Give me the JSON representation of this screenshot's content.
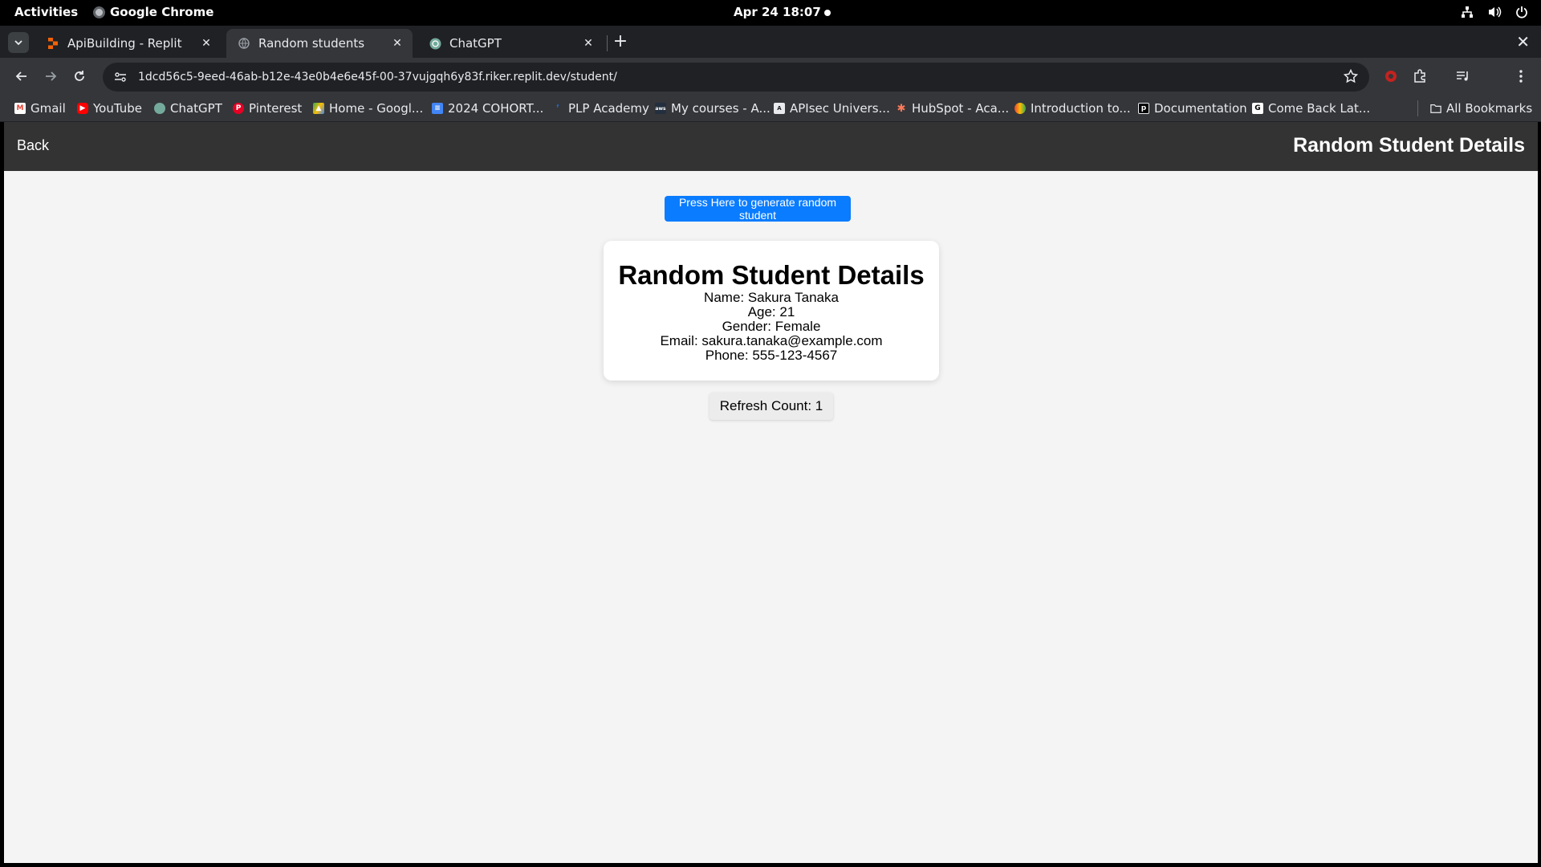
{
  "system": {
    "activities": "Activities",
    "app_name": "Google Chrome",
    "clock": "Apr 24  18:07"
  },
  "tabs": [
    {
      "title": "ApiBuilding - Replit",
      "icon": "replit-icon",
      "active": false
    },
    {
      "title": "Random students",
      "icon": "globe-icon",
      "active": true
    },
    {
      "title": "ChatGPT",
      "icon": "chatgpt-icon",
      "active": false
    }
  ],
  "toolbar": {
    "url": "1dcd56c5-9eed-46ab-b12e-43e0b4e6e45f-00-37vujgqh6y83f.riker.replit.dev/student/"
  },
  "bookmarks": [
    {
      "label": "Gmail",
      "color": "#ea4335"
    },
    {
      "label": "YouTube",
      "color": "#ff0000"
    },
    {
      "label": "ChatGPT",
      "color": "#74aa9c"
    },
    {
      "label": "Pinterest",
      "color": "#e60023"
    },
    {
      "label": "Home - Googl...",
      "color": "#34a853"
    },
    {
      "label": "2024 COHORT...",
      "color": "#4285f4"
    },
    {
      "label": "PLP Academy",
      "color": "#1a73e8"
    },
    {
      "label": "My courses - A...",
      "color": "#232f3e"
    },
    {
      "label": "APIsec Univers...",
      "color": "#5f6368"
    },
    {
      "label": "HubSpot - Aca...",
      "color": "#ff7a59"
    },
    {
      "label": "Introduction to...",
      "color": "#fbbc04"
    },
    {
      "label": "Documentation",
      "color": "#000000"
    },
    {
      "label": "Come Back Lat...",
      "color": "#ffffff"
    }
  ],
  "all_bookmarks": "All Bookmarks",
  "page": {
    "back_label": "Back",
    "header_title": "Random Student Details",
    "generate_button": "Press Here to generate random student",
    "card_title": "Random Student Details",
    "name_line": "Name: Sakura Tanaka",
    "age_line": "Age: 21",
    "gender_line": "Gender: Female",
    "email_line": "Email: sakura.tanaka@example.com",
    "phone_line": "Phone: 555-123-4567",
    "refresh_count": "Refresh Count: 1"
  },
  "colors": {
    "header_bg": "#333333",
    "page_bg": "#f4f4f4",
    "button_blue": "#0a7cff"
  }
}
